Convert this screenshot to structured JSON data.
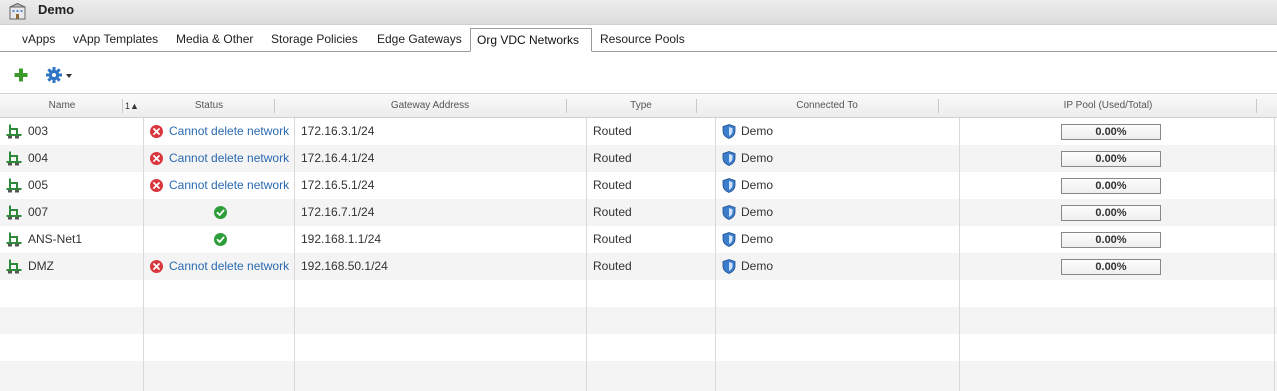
{
  "window": {
    "title": "Demo"
  },
  "tabs": [
    {
      "label": "vApps"
    },
    {
      "label": "vApp Templates"
    },
    {
      "label": "Media & Other"
    },
    {
      "label": "Storage Policies"
    },
    {
      "label": "Edge Gateways"
    },
    {
      "label": "Org VDC Networks",
      "active": true
    },
    {
      "label": "Resource Pools"
    }
  ],
  "toolbar": {
    "add_icon": "plus-icon",
    "actions_icon": "gear-dropdown-icon"
  },
  "columns": {
    "name": "Name",
    "sort_order": "1",
    "status": "Status",
    "gateway": "Gateway Address",
    "type": "Type",
    "connected_to": "Connected To",
    "ip_pool": "IP Pool (Used/Total)"
  },
  "rows": [
    {
      "name": "003",
      "status": "error",
      "status_text": "Cannot delete network",
      "gateway": "172.16.3.1/24",
      "type": "Routed",
      "connected_to": "Demo",
      "ip_pool": "0.00%"
    },
    {
      "name": "004",
      "status": "error",
      "status_text": "Cannot delete network",
      "gateway": "172.16.4.1/24",
      "type": "Routed",
      "connected_to": "Demo",
      "ip_pool": "0.00%"
    },
    {
      "name": "005",
      "status": "error",
      "status_text": "Cannot delete network",
      "gateway": "172.16.5.1/24",
      "type": "Routed",
      "connected_to": "Demo",
      "ip_pool": "0.00%"
    },
    {
      "name": "007",
      "status": "ok",
      "status_text": "",
      "gateway": "172.16.7.1/24",
      "type": "Routed",
      "connected_to": "Demo",
      "ip_pool": "0.00%"
    },
    {
      "name": "ANS-Net1",
      "status": "ok",
      "status_text": "",
      "gateway": "192.168.1.1/24",
      "type": "Routed",
      "connected_to": "Demo",
      "ip_pool": "0.00%"
    },
    {
      "name": "DMZ",
      "status": "error",
      "status_text": "Cannot delete network",
      "gateway": "192.168.50.1/24",
      "type": "Routed",
      "connected_to": "Demo",
      "ip_pool": "0.00%"
    }
  ],
  "colors": {
    "link": "#2a6ab1",
    "error": "#d9363e",
    "ok": "#2e9e3a",
    "add": "#3a9a2a",
    "gear": "#2f76c5"
  }
}
